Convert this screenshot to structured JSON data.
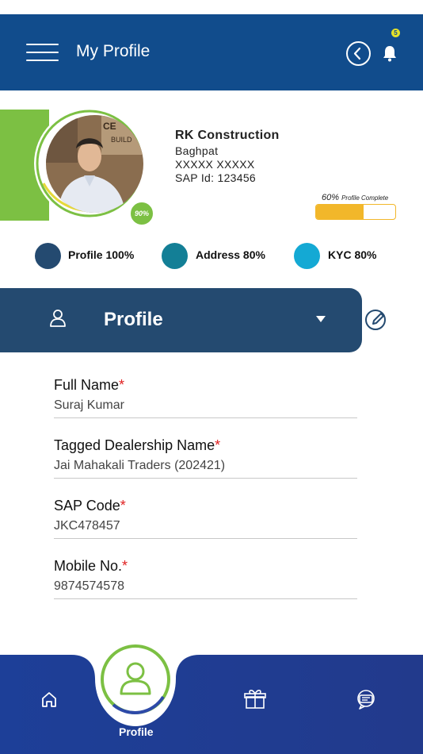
{
  "header": {
    "title": "My Profile",
    "notification_count": "5"
  },
  "profile": {
    "avatar_percent": "90%",
    "company_name": "RK Construction",
    "location": "Baghpat",
    "masked_name": "XXXXX XXXXX",
    "sap_id": "SAP Id: 123456",
    "complete_percent_text": "60%",
    "complete_label": "Profile Complete",
    "complete_fraction": 0.6
  },
  "legend": [
    {
      "label": "Profile 100%",
      "color": "#244a70"
    },
    {
      "label": "Address 80%",
      "color": "#137f96"
    },
    {
      "label": "KYC 80%",
      "color": "#14a9d4"
    }
  ],
  "section": {
    "title": "Profile"
  },
  "form": {
    "full_name": {
      "label": "Full Name",
      "required": "*",
      "value": "Suraj Kumar"
    },
    "dealership": {
      "label": "Tagged Dealership Name",
      "required": "*",
      "value": "Jai Mahakali Traders (202421)"
    },
    "sap_code": {
      "label": "SAP Code",
      "required": "*",
      "value": "JKC478457"
    },
    "mobile": {
      "label": "Mobile No.",
      "required": "*",
      "value": "9874574578"
    }
  },
  "bottom_nav": {
    "profile_label": "Profile",
    "icons": [
      "home-icon",
      "user-icon",
      "gift-box-icon",
      "support-chat-icon"
    ]
  },
  "colors": {
    "header_bg": "#114c8c",
    "accent_green": "#7cc043",
    "progress_yellow": "#f2b72a",
    "section_bar": "#244a70",
    "nav_bg": "#1d3f98"
  }
}
